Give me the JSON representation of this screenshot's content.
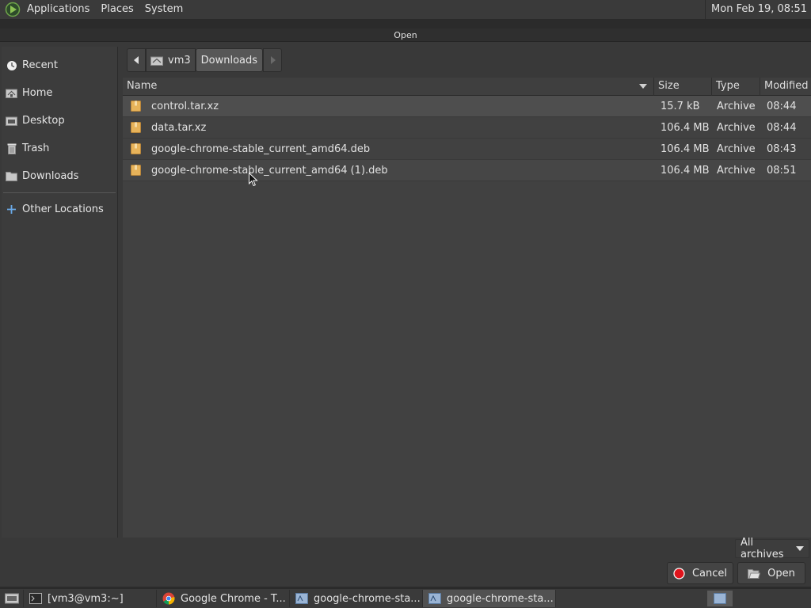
{
  "top_panel": {
    "menus": [
      "Applications",
      "Places",
      "System"
    ],
    "clock": "Mon Feb 19, 08:51"
  },
  "dialog": {
    "title": "Open",
    "sidebar": {
      "items": [
        {
          "label": "Recent",
          "icon": "recent-icon"
        },
        {
          "label": "Home",
          "icon": "home-icon"
        },
        {
          "label": "Desktop",
          "icon": "desktop-icon"
        },
        {
          "label": "Trash",
          "icon": "trash-icon"
        },
        {
          "label": "Downloads",
          "icon": "folder-icon"
        }
      ],
      "other": {
        "label": "Other Locations",
        "icon": "plus-icon"
      }
    },
    "path": {
      "segments": [
        "vm3",
        "Downloads"
      ],
      "current": "Downloads"
    },
    "columns": {
      "name": "Name",
      "size": "Size",
      "type": "Type",
      "modified": "Modified"
    },
    "files": [
      {
        "name": "control.tar.xz",
        "size": "15.7 kB",
        "type": "Archive",
        "modified": "08:44"
      },
      {
        "name": "data.tar.xz",
        "size": "106.4 MB",
        "type": "Archive",
        "modified": "08:44"
      },
      {
        "name": "google-chrome-stable_current_amd64.deb",
        "size": "106.4 MB",
        "type": "Archive",
        "modified": "08:43"
      },
      {
        "name": "google-chrome-stable_current_amd64 (1).deb",
        "size": "106.4 MB",
        "type": "Archive",
        "modified": "08:51"
      }
    ],
    "filter": "All archives",
    "buttons": {
      "cancel": "Cancel",
      "open": "Open"
    }
  },
  "taskbar": {
    "tasks": [
      {
        "label": "[vm3@vm3:~]"
      },
      {
        "label": "Google Chrome - T..."
      },
      {
        "label": "google-chrome-sta..."
      },
      {
        "label": "google-chrome-sta..."
      }
    ]
  },
  "colors": {
    "panel": "#3a3a3a",
    "dialog": "#393939",
    "list": "#414141",
    "folder": "#e7b35a",
    "cancel_red": "#e0141c"
  }
}
